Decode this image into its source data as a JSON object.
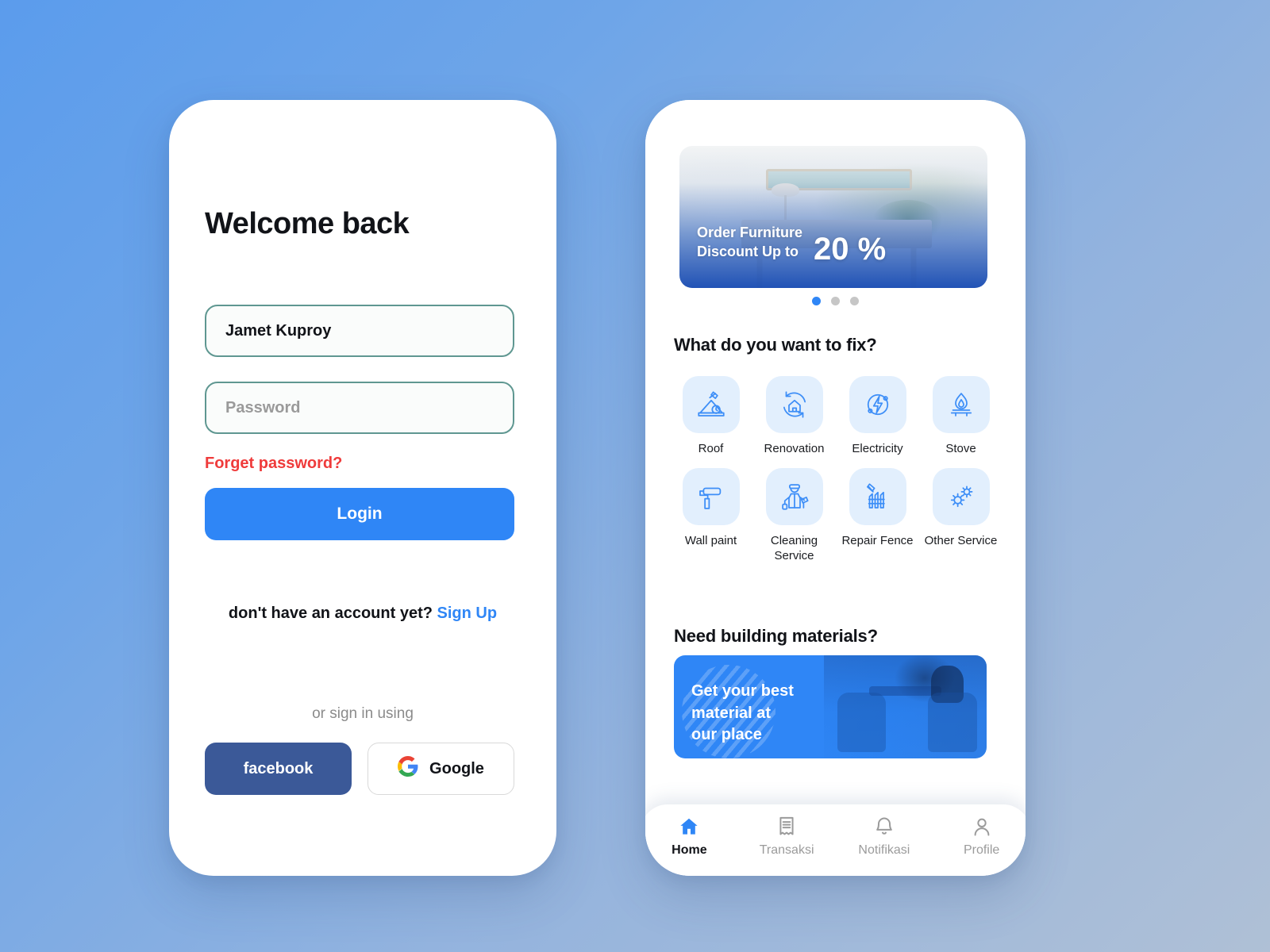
{
  "login": {
    "title": "Welcome back",
    "username_value": "Jamet Kuproy",
    "password_placeholder": "Password",
    "forget_password": "Forget password?",
    "login_button": "Login",
    "signup_prompt": "don't have an account yet?",
    "signup_link": "Sign Up",
    "or_text": "or sign in using",
    "facebook_label": "facebook",
    "google_label": "Google",
    "colors": {
      "primary": "#2F86F6",
      "danger": "#EF3B3B",
      "field_border": "#5F9791",
      "facebook": "#3B5998"
    }
  },
  "home": {
    "promo": {
      "line1": "Order Furniture",
      "line2": "Discount Up to",
      "percent": "20 %",
      "dots_total": 3,
      "active_dot": 1
    },
    "fix_section_title": "What do you want to fix?",
    "services": [
      {
        "label": "Roof",
        "icon": "roof-hammer-icon"
      },
      {
        "label": "Renovation",
        "icon": "house-refresh-icon"
      },
      {
        "label": "Electricity",
        "icon": "lightning-circle-icon"
      },
      {
        "label": "Stove",
        "icon": "stove-flame-icon"
      },
      {
        "label": "Wall paint",
        "icon": "paint-roller-icon"
      },
      {
        "label": "Cleaning Service",
        "icon": "cleaner-person-icon"
      },
      {
        "label": "Repair Fence",
        "icon": "fence-hammer-icon"
      },
      {
        "label": "Other Service",
        "icon": "gears-icon"
      }
    ],
    "materials_section_title": "Need building materials?",
    "materials_banner": {
      "line1": "Get your best",
      "line2": "material at",
      "line3": "our place"
    },
    "bottom_nav": [
      {
        "label": "Home",
        "icon": "home-icon",
        "active": true
      },
      {
        "label": "Transaksi",
        "icon": "receipt-icon",
        "active": false
      },
      {
        "label": "Notifikasi",
        "icon": "bell-icon",
        "active": false
      },
      {
        "label": "Profile",
        "icon": "person-icon",
        "active": false
      }
    ],
    "colors": {
      "accent": "#2F86F6",
      "tile_bg": "#E2EFFD",
      "inactive": "#9B9B9B"
    }
  }
}
